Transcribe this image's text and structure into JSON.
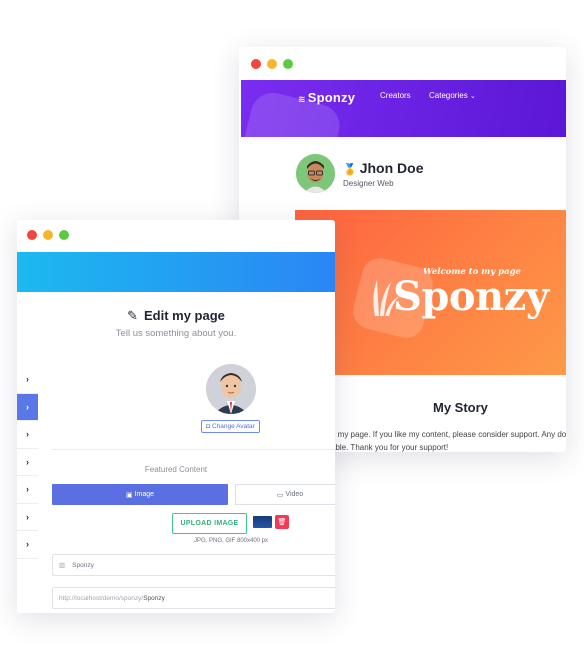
{
  "back": {
    "brand": "Sponzy",
    "nav": [
      {
        "label": "Creators"
      },
      {
        "label": "Categories"
      }
    ],
    "profile": {
      "name": "Jhon Doe",
      "role": "Designer Web"
    },
    "banner": {
      "small": "Welcome to my page",
      "big": "Sponzy"
    },
    "story": {
      "title": "My Story",
      "line1": "o my page. If you like my content, please consider support. Any do",
      "line2": "able. Thank you for your support!"
    }
  },
  "front": {
    "title": "Edit my page",
    "subtitle": "Tell us something about you.",
    "change_avatar": "Change Avatar",
    "featured_label": "Featured Content",
    "segment_image": "Image",
    "segment_video": "Video",
    "upload_label": "UPLOAD IMAGE",
    "upload_hint": "JPG, PNG, GIF 800x400 px",
    "name_value": "Sponzy",
    "url_prefix": "http://localhost/demo/sponzy/",
    "url_value": "Sponzy",
    "side_tab_glyph": "›",
    "delete_glyph": "🗑"
  },
  "colors": {
    "nav": "#6a21e4",
    "banner": "#fe7f43",
    "front_header": "#1cb9f0",
    "active_tab": "#5878e8",
    "upload_green": "#3dc78a",
    "delete_red": "#ef3b56"
  }
}
